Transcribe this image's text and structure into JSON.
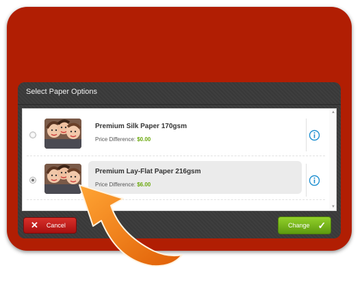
{
  "dialog": {
    "title": "Select Paper Options"
  },
  "options": [
    {
      "name": "Premium Silk Paper 170gsm",
      "price_label": "Price Difference:",
      "price_value": "$0.00",
      "selected": false
    },
    {
      "name": "Premium Lay-Flat Paper 216gsm",
      "price_label": "Price Difference:",
      "price_value": "$6.00",
      "selected": true
    }
  ],
  "buttons": {
    "cancel": "Cancel",
    "change": "Change"
  },
  "icons": {
    "cancel": "close-x-icon",
    "change": "checkmark-icon",
    "info": "info-icon",
    "annotation": "curved-arrow-icon"
  },
  "colors": {
    "frame": "#b11e03",
    "dialog": "#3a3a3a",
    "cancel": "#c0201b",
    "change": "#7ab81d",
    "price": "#6aa80c",
    "info": "#1e8fd0",
    "arrow": "#f07a10"
  }
}
